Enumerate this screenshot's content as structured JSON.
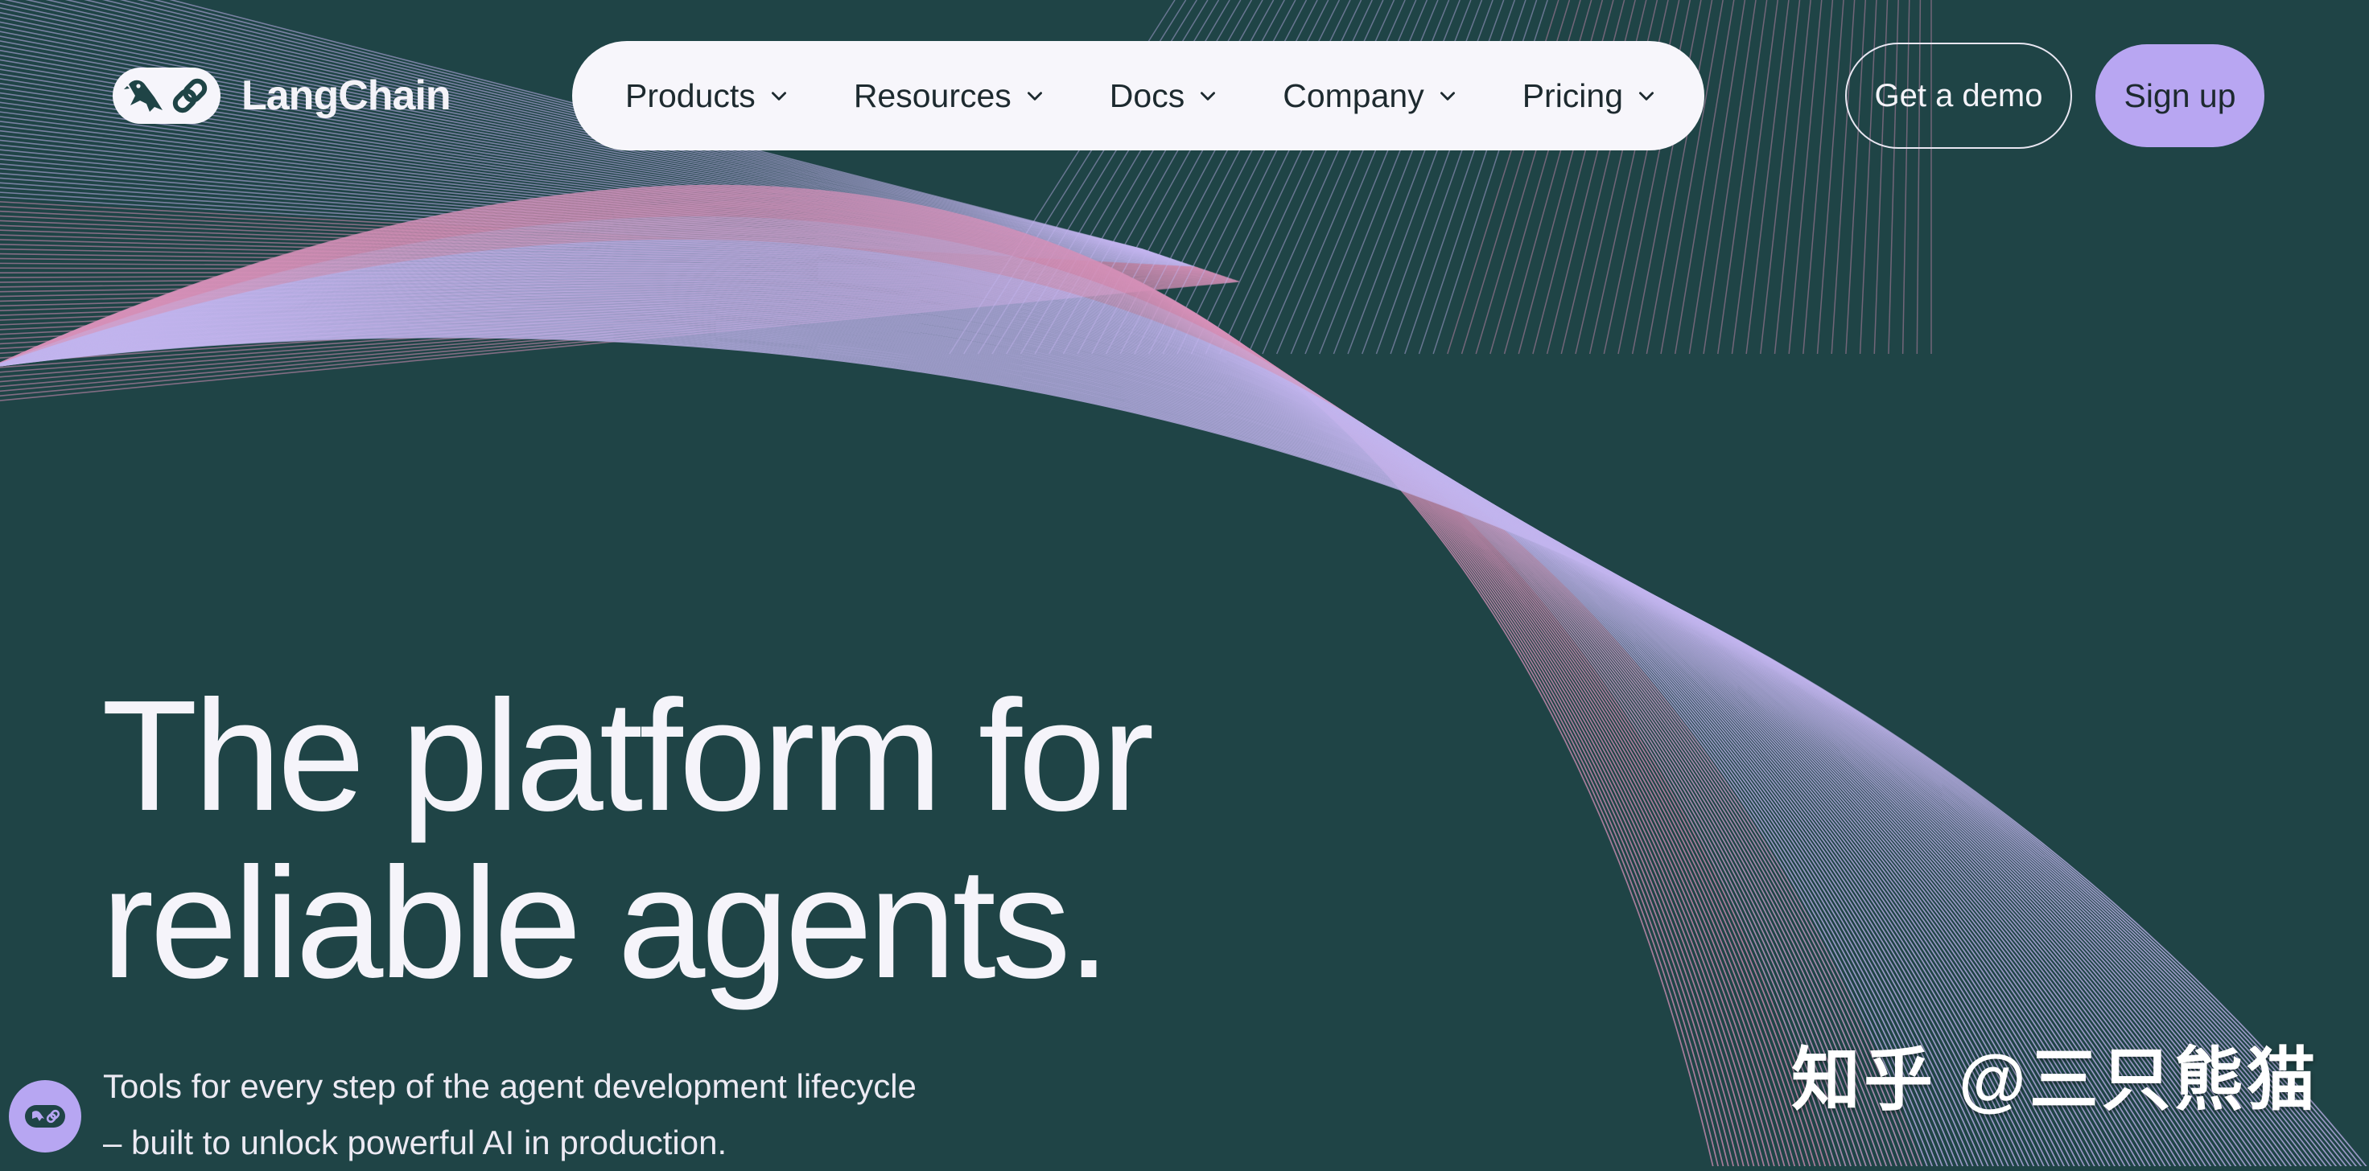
{
  "brand": {
    "name": "LangChain",
    "logo_icon": "parrot-link-icon"
  },
  "nav": {
    "items": [
      {
        "label": "Products",
        "icon": "chevron-down-icon"
      },
      {
        "label": "Resources",
        "icon": "chevron-down-icon"
      },
      {
        "label": "Docs",
        "icon": "chevron-down-icon"
      },
      {
        "label": "Company",
        "icon": "chevron-down-icon"
      },
      {
        "label": "Pricing",
        "icon": "chevron-down-icon"
      }
    ]
  },
  "actions": {
    "demo_label": "Get a demo",
    "signup_label": "Sign up"
  },
  "hero": {
    "title_line1": "The platform for",
    "title_line2": "reliable agents.",
    "subtitle_line1": "Tools for every step of the agent development lifecycle",
    "subtitle_line2": "– built to unlock powerful AI in production."
  },
  "chat_widget": {
    "icon": "langchain-chat-icon"
  },
  "watermark": {
    "text": "知乎 @三只熊猫"
  },
  "colors": {
    "background": "#1f4446",
    "nav_pill": "#f7f6fb",
    "accent_purple": "#b8a6f2",
    "line_pink": "#d690b8",
    "line_lavender": "#c2b4ee",
    "text_light": "#f5f4fa",
    "text_dark": "#1d2a2f"
  }
}
